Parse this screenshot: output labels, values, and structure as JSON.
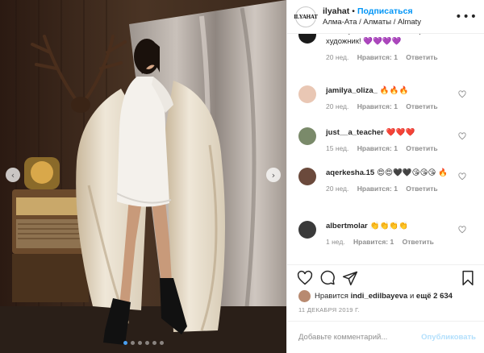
{
  "post": {
    "username": "ilyahat",
    "separator": "•",
    "follow_label": "Подписаться",
    "location": "Алма-Ата / Алматы / Almaty",
    "logo_text": "ILYAHAT"
  },
  "comments": [
    {
      "text": "не оторвать! Вы - настоящий художник! 💜💜💜💜",
      "age": "20 нед.",
      "likes": "Нравится: 1",
      "reply": "Ответить"
    },
    {
      "user": "jamilya_oliza_",
      "text": "🔥🔥🔥",
      "age": "20 нед.",
      "likes": "Нравится: 1",
      "reply": "Ответить",
      "avatar_color": "#e9c7b4"
    },
    {
      "user": "just__a_teacher",
      "text": "❤️❤️❤️",
      "age": "15 нед.",
      "likes": "Нравится: 1",
      "reply": "Ответить",
      "avatar_color": "#7a8a6a"
    },
    {
      "user": "aqerkesha.15",
      "text": "😍😍🖤🖤😘😘😘 🔥",
      "age": "20 нед.",
      "likes": "Нравится: 1",
      "reply": "Ответить",
      "avatar_color": "#6b4a3c"
    },
    {
      "user": "albertmolar",
      "text": "👏👏👏👏",
      "age": "1 нед.",
      "likes": "Нравится: 1",
      "reply": "Ответить",
      "avatar_color": "#3a3a3a"
    }
  ],
  "likes": {
    "prefix": "Нравится",
    "user": "indi_edilbayeva",
    "conj": "и",
    "others": "ещё 2 634"
  },
  "date": "11 ДЕКАБРЯ 2019 Г.",
  "add_comment": {
    "placeholder": "Добавьте комментарий...",
    "publish_label": "Опубликовать"
  },
  "carousel": {
    "total_dots": 6,
    "active_dot": 0
  },
  "colors": {
    "accent": "#0095f6",
    "muted": "#8e8e8e",
    "publish_disabled": "#b2dffc"
  },
  "icons": [
    "chevron-left-icon",
    "chevron-right-icon",
    "more-icon",
    "heart-icon",
    "comment-icon",
    "share-icon",
    "bookmark-icon"
  ]
}
